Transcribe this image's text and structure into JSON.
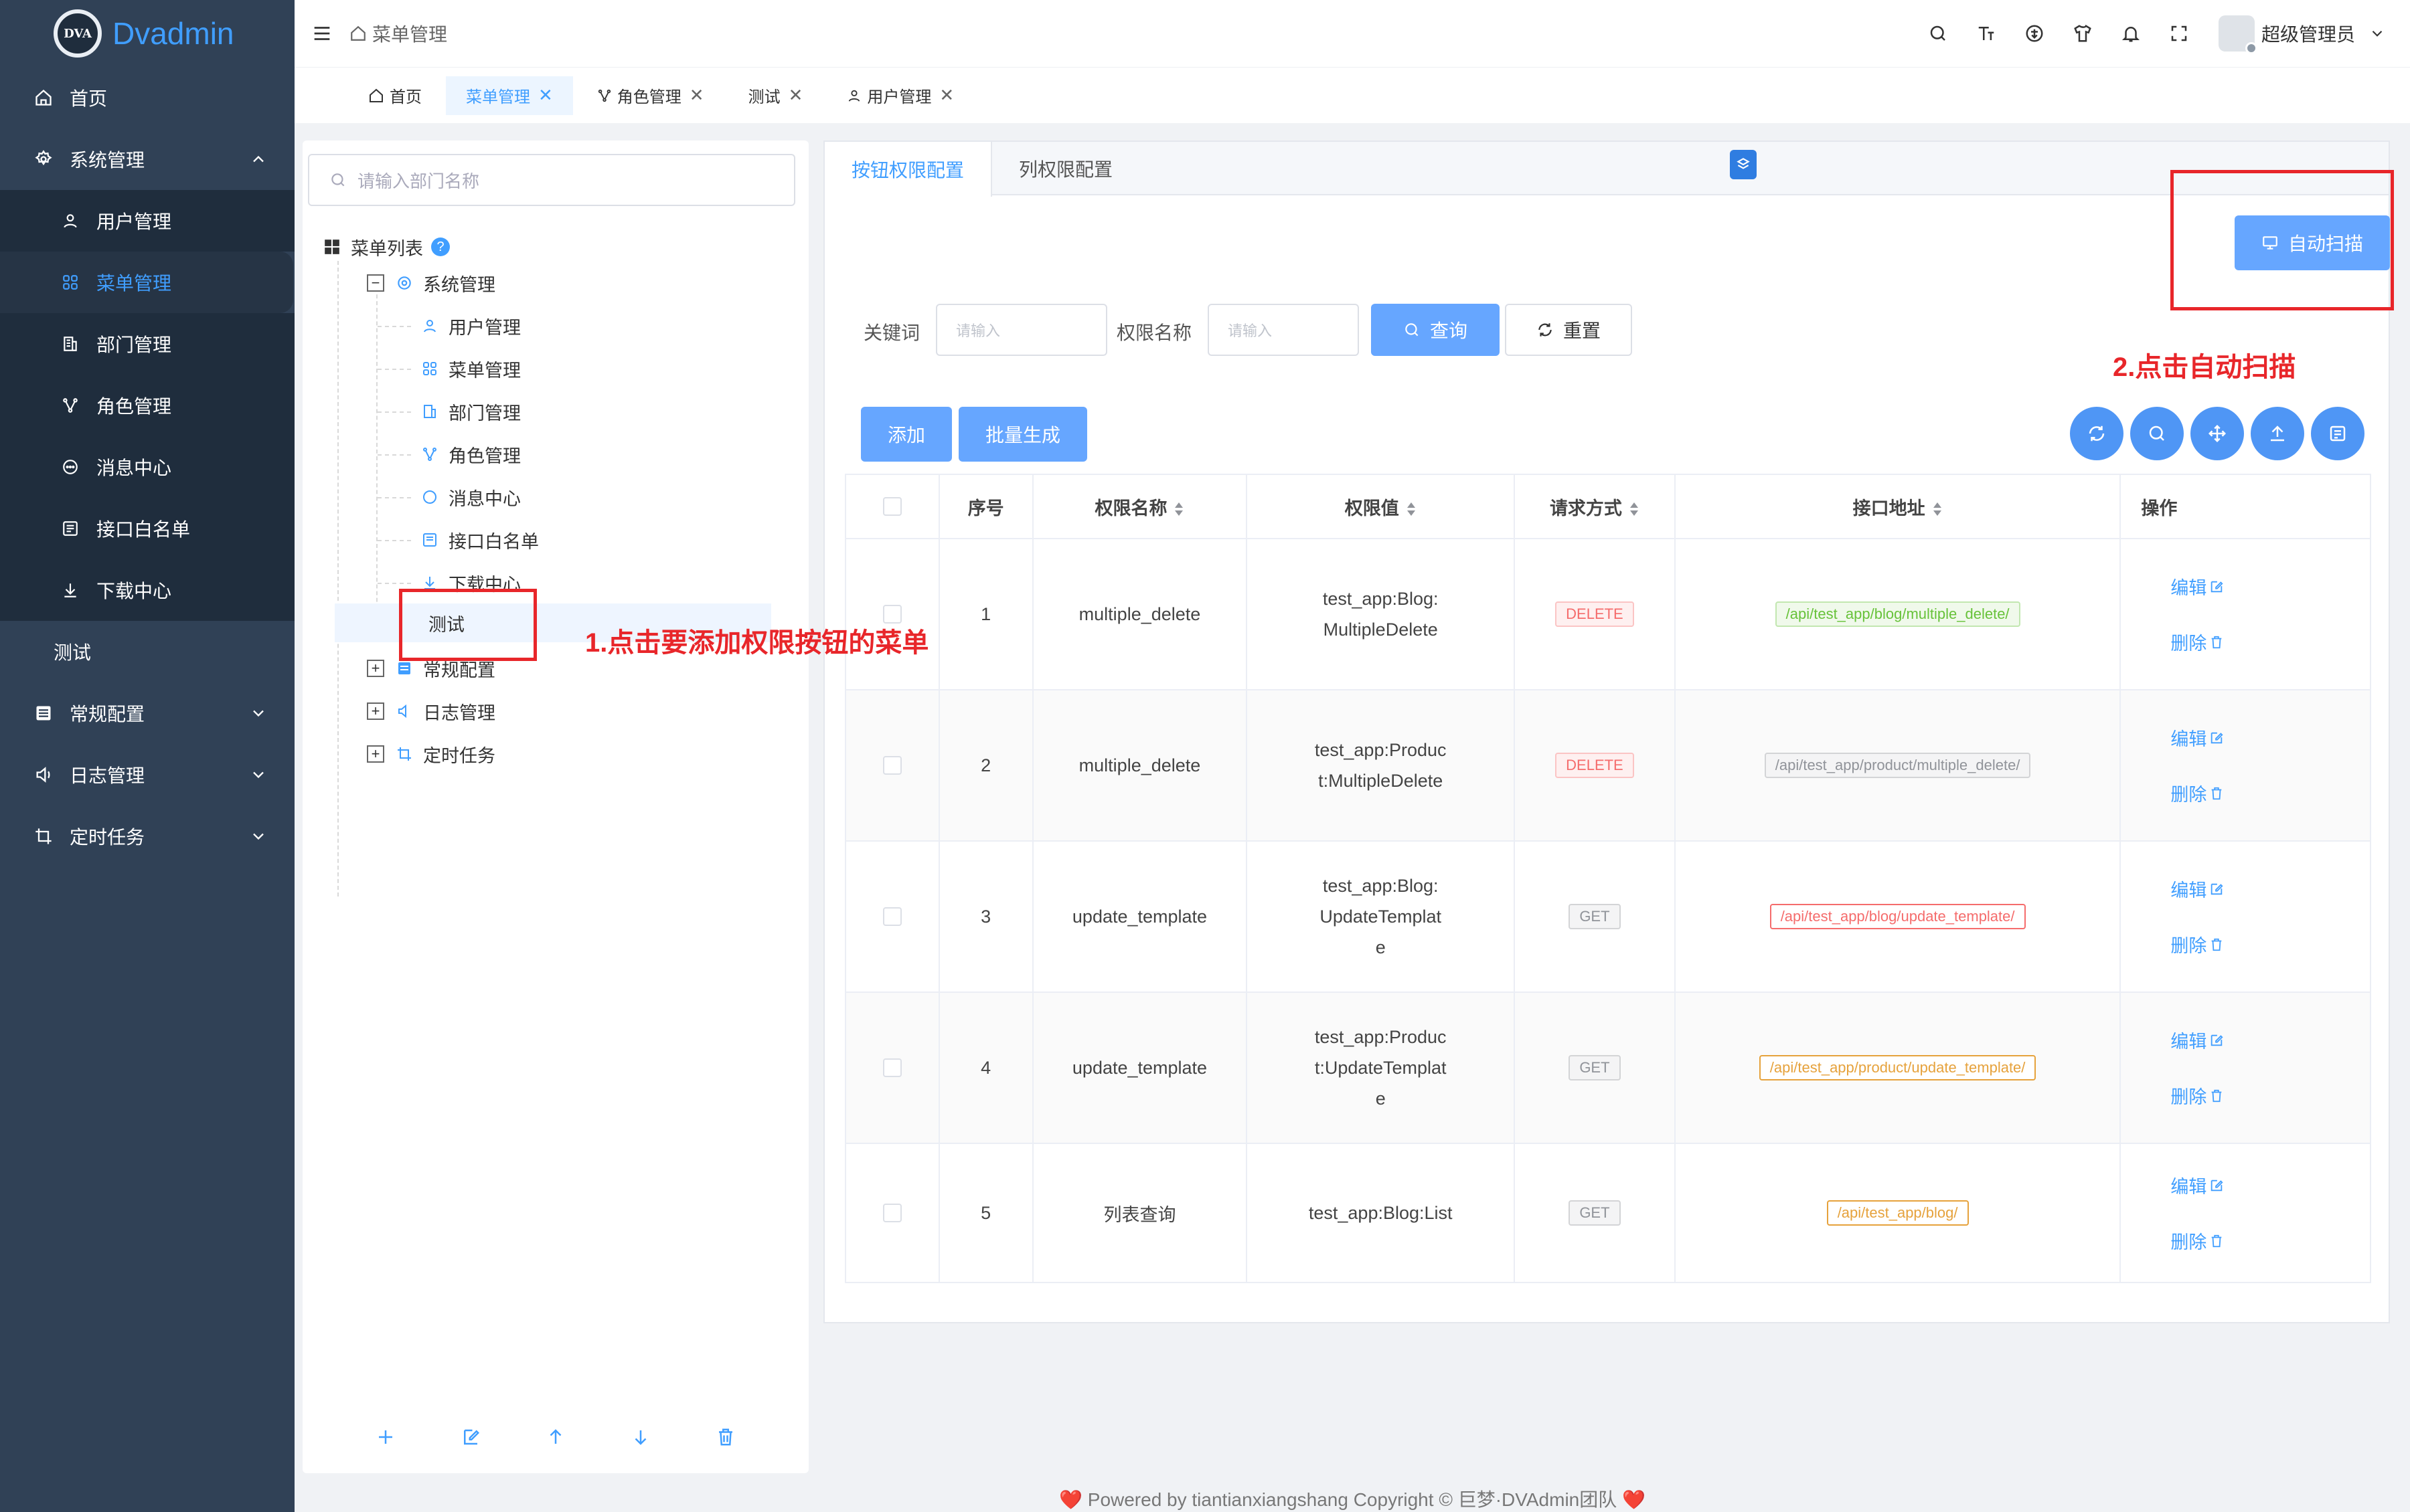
{
  "app": {
    "brand": "Dvadmin",
    "logo_text": "DVA"
  },
  "sidebar": {
    "items": [
      {
        "label": "首页",
        "icon": "home-icon"
      },
      {
        "label": "系统管理",
        "icon": "gear-icon"
      },
      {
        "label": "用户管理",
        "icon": "user-icon"
      },
      {
        "label": "菜单管理",
        "icon": "grid-icon"
      },
      {
        "label": "部门管理",
        "icon": "building-icon"
      },
      {
        "label": "角色管理",
        "icon": "role-icon"
      },
      {
        "label": "消息中心",
        "icon": "chat-icon"
      },
      {
        "label": "接口白名单",
        "icon": "list-icon"
      },
      {
        "label": "下载中心",
        "icon": "download-icon"
      },
      {
        "label": "测试",
        "icon": ""
      },
      {
        "label": "常规配置",
        "icon": "config-icon"
      },
      {
        "label": "日志管理",
        "icon": "log-icon"
      },
      {
        "label": "定时任务",
        "icon": "crop-icon"
      }
    ]
  },
  "header": {
    "breadcrumb": "菜单管理",
    "user_name": "超级管理员"
  },
  "tags": [
    {
      "label": "首页"
    },
    {
      "label": "菜单管理",
      "close": "✕"
    },
    {
      "label": "角色管理",
      "close": "✕"
    },
    {
      "label": "测试",
      "close": "✕"
    },
    {
      "label": "用户管理",
      "close": "✕"
    }
  ],
  "tree": {
    "search_placeholder": "请输入部门名称",
    "root": "菜单列表",
    "help": "?",
    "group1": "系统管理",
    "children": [
      "用户管理",
      "菜单管理",
      "部门管理",
      "角色管理",
      "消息中心",
      "接口白名单",
      "下载中心"
    ],
    "selected": "测试",
    "group2": "常规配置",
    "group3": "日志管理",
    "group4": "定时任务",
    "minus": "−",
    "plus": "+"
  },
  "main": {
    "tabs": [
      "按钮权限配置",
      "列权限配置"
    ],
    "auto_scan": "自动扫描",
    "filters": {
      "keyword_label": "关键词",
      "keyword_placeholder": "请输入",
      "perm_label": "权限名称",
      "perm_placeholder": "请输入",
      "query": "查询",
      "reset": "重置"
    },
    "add": "添加",
    "batch": "批量生成",
    "columns": [
      "序号",
      "权限名称",
      "权限值",
      "请求方式",
      "接口地址",
      "操作"
    ],
    "rows": [
      {
        "idx": "1",
        "name": "multiple_delete",
        "value": "test_app:Blog:MultipleDelete",
        "method": "DELETE",
        "api": "/api/test_app/blog/multiple_delete/"
      },
      {
        "idx": "2",
        "name": "multiple_delete",
        "value": "test_app:Product:MultipleDelete",
        "method": "DELETE",
        "api": "/api/test_app/product/multiple_delete/"
      },
      {
        "idx": "3",
        "name": "update_template",
        "value": "test_app:Blog:UpdateTemplate",
        "method": "GET",
        "api": "/api/test_app/blog/update_template/"
      },
      {
        "idx": "4",
        "name": "update_template",
        "value": "test_app:Product:UpdateTemplate",
        "method": "GET",
        "api": "/api/test_app/product/update_template/"
      },
      {
        "idx": "5",
        "name": "列表查询",
        "value": "test_app:Blog:List",
        "method": "GET",
        "api": "/api/test_app/blog/"
      }
    ],
    "edit": "编辑",
    "delete": "删除"
  },
  "annotations": {
    "step1": "1.点击要添加权限按钮的菜单",
    "step2": "2.点击自动扫描"
  },
  "footer": {
    "text": "Powered by tiantianxiangshang Copyright © 巨梦·DVAdmin团队",
    "heart": "❤️"
  },
  "colors": {
    "primary": "#409eff",
    "sidebar_bg": "#304156",
    "annotation": "#e8262a"
  }
}
